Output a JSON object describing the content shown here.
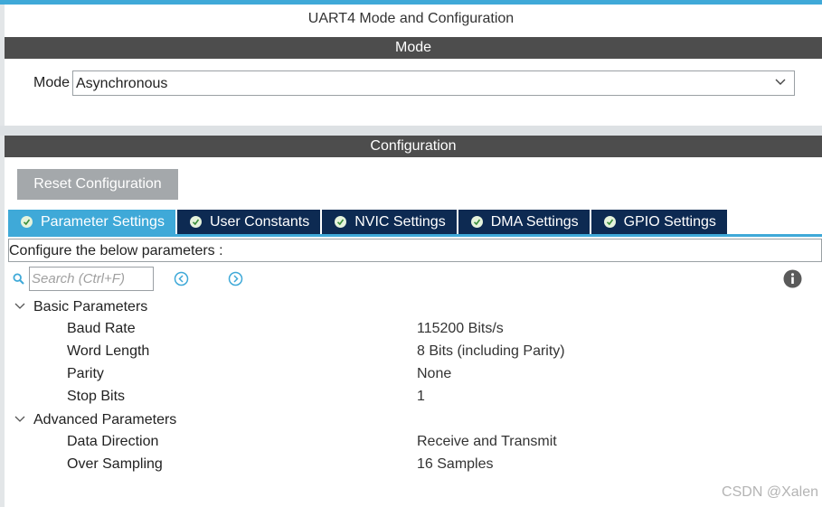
{
  "window": {
    "title": "UART4 Mode and Configuration"
  },
  "mode_section": {
    "header": "Mode",
    "mode_label": "Mode",
    "mode_value": "Asynchronous"
  },
  "config_section": {
    "header": "Configuration",
    "reset_button": "Reset Configuration",
    "tabs": [
      {
        "label": "Parameter Settings",
        "active": true
      },
      {
        "label": "User Constants",
        "active": false
      },
      {
        "label": "NVIC Settings",
        "active": false
      },
      {
        "label": "DMA Settings",
        "active": false
      },
      {
        "label": "GPIO Settings",
        "active": false
      }
    ],
    "instruction": "Configure the below parameters :",
    "search_placeholder": "Search (Ctrl+F)"
  },
  "parameters": {
    "basic": {
      "title": "Basic Parameters",
      "rows": [
        {
          "name": "Baud Rate",
          "value": "115200 Bits/s"
        },
        {
          "name": "Word Length",
          "value": "8 Bits (including Parity)"
        },
        {
          "name": "Parity",
          "value": "None"
        },
        {
          "name": "Stop Bits",
          "value": "1"
        }
      ]
    },
    "advanced": {
      "title": "Advanced Parameters",
      "rows": [
        {
          "name": "Data Direction",
          "value": "Receive and Transmit"
        },
        {
          "name": "Over Sampling",
          "value": "16 Samples"
        }
      ]
    }
  },
  "watermark": "CSDN @Xalen",
  "colors": {
    "accent": "#3fa9d8",
    "tab_inactive": "#0d2a52",
    "section_bar": "#4d4d4d",
    "button_gray": "#a4a8ab"
  },
  "icons": {
    "search": "search-icon",
    "prev": "arrow-left-circle-icon",
    "next": "arrow-right-circle-icon",
    "info": "info-icon",
    "dropdown": "chevron-down-icon",
    "tab_check": "check-circle-icon"
  }
}
